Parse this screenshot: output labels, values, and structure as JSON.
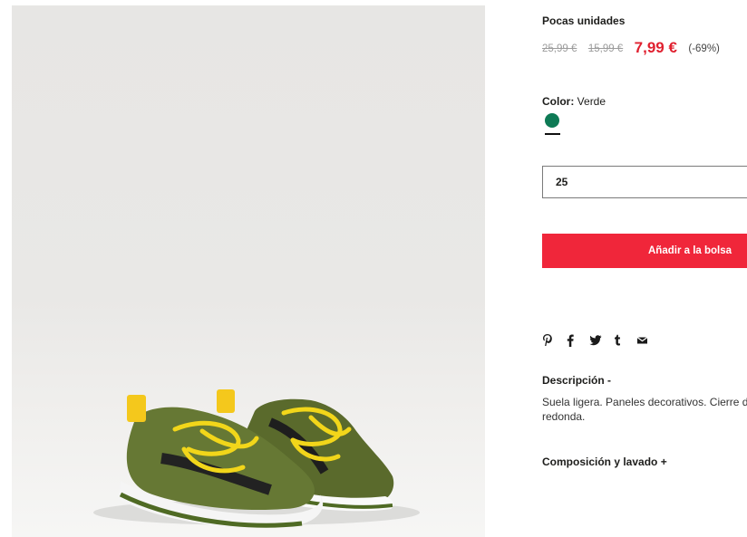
{
  "product": {
    "image_alt": "green sneakers with yellow laces",
    "stock_notice": "Pocas unidades",
    "prices": {
      "original": "25,99 €",
      "previous": "15,99 €",
      "current": "7,99 €",
      "discount": "(-69%)"
    },
    "color": {
      "label": "Color:",
      "value": "Verde",
      "swatch_hex": "#0e7a55"
    },
    "size": {
      "selected": "25"
    },
    "add_to_bag_label": "Añadir a la bolsa",
    "share_icons": [
      "pinterest-icon",
      "facebook-icon",
      "twitter-icon",
      "tumblr-icon",
      "mail-icon"
    ],
    "description": {
      "title": "Descripción -",
      "text_line1": "Suela ligera. Paneles decorativos. Cierre de",
      "text_line2": "redonda."
    },
    "composition_title": "Composición y lavado +"
  },
  "colors": {
    "accent": "#f0263a",
    "price_red": "#e0202f"
  }
}
